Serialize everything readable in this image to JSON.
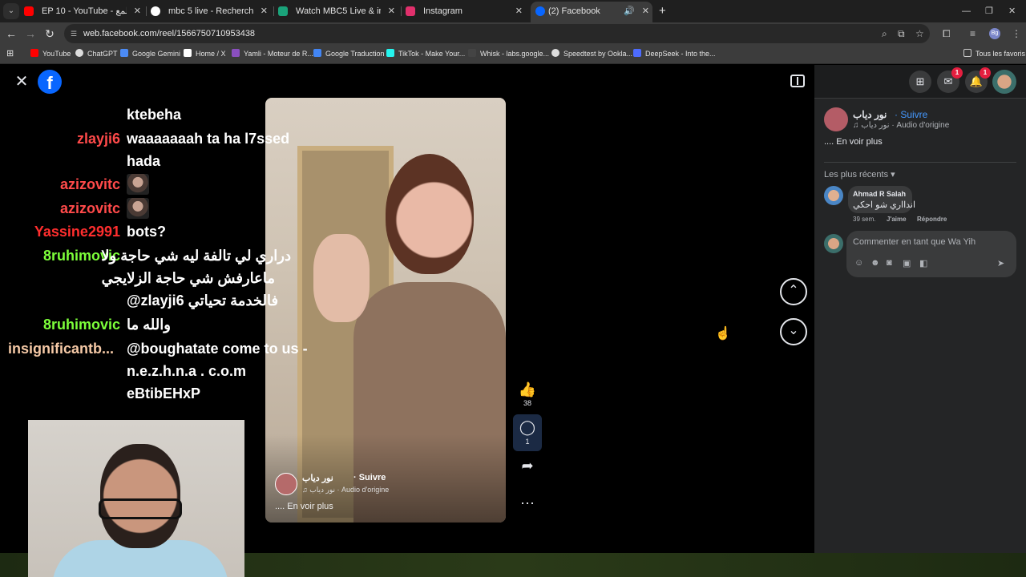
{
  "browser": {
    "tabs": [
      {
        "title": "EP 10 - YouTube - عش الطمع",
        "fav_color": "#ff0000",
        "close": "✕"
      },
      {
        "title": "mbc 5 live - Recherche Google",
        "fav_color": "#ffffff",
        "close": "✕"
      },
      {
        "title": "Watch MBC5 Live & in HD | Sh...",
        "fav_color": "#1aa37a",
        "close": "✕"
      },
      {
        "title": "Instagram",
        "fav_color": "#e1306c",
        "close": "✕"
      },
      {
        "title": "(2) Facebook",
        "fav_color": "#0866ff",
        "close": "✕"
      }
    ],
    "url": "web.facebook.com/reel/1566750710953438",
    "profile_initials": "Bg",
    "bookmarks": [
      {
        "label": "YouTube",
        "color": "#ff0000"
      },
      {
        "label": "ChatGPT",
        "color": "#dddddd"
      },
      {
        "label": "Google Gemini",
        "color": "#4c8bf5"
      },
      {
        "label": "Home / X",
        "color": "#ffffff"
      },
      {
        "label": "Yamli - Moteur de R...",
        "color": "#8a4fbf"
      },
      {
        "label": "Google Traduction",
        "color": "#4285f4"
      },
      {
        "label": "TikTok - Make Your...",
        "color": "#25f4ee"
      },
      {
        "label": "Whisk - labs.google...",
        "color": "#444444"
      },
      {
        "label": "Speedtest by Ookla...",
        "color": "#dddddd"
      },
      {
        "label": "DeepSeek - Into the...",
        "color": "#4d6bfe"
      }
    ],
    "all_bookmarks": "Tous les favoris"
  },
  "chat": [
    {
      "user": "",
      "user_color": "#ffffff",
      "lines": [
        "ktebeha"
      ]
    },
    {
      "user": "zlayji6",
      "user_color": "#ff4a4a",
      "lines": [
        "waaaaaaah ta ha l7ssed",
        "hada"
      ]
    },
    {
      "user": "azizovitc",
      "user_color": "#ff4a4a",
      "emote": true
    },
    {
      "user": "azizovitc",
      "user_color": "#ff4a4a",
      "emote": true
    },
    {
      "user": "Yassine2991",
      "user_color": "#ff2e2e",
      "lines": [
        "bots?"
      ]
    },
    {
      "user": "8ruhimovic",
      "user_color": "#7dff3a",
      "lines": [
        "دراري لي تالفة ليه شي حاجة ولا",
        "ماعارفش شي حاجة الزلايجي",
        "@zlayji6 فالخدمة تحياتي"
      ]
    },
    {
      "user": "8ruhimovic",
      "user_color": "#7dff3a",
      "lines": [
        "والله ما"
      ]
    },
    {
      "user": "insignificantb...",
      "user_color": "#f5c9a6",
      "lines": [
        "@boughatate come to us -",
        "n.e.z.h.n.a . c.o.m",
        "eBtibEHxP"
      ]
    }
  ],
  "reel": {
    "author": "نور دياب",
    "follow": "· Suivre",
    "audio": "♫ نور دياب · Audio d'origine",
    "see_more": ".... En voir plus",
    "likes": "38",
    "comments": "1"
  },
  "sidebar": {
    "notif_badge": "1",
    "messenger_badge": "1",
    "author": "نور دياب",
    "follow": "· Suivre",
    "audio": "♫ نور دياب · Audio d'origine",
    "see_more": ".... En voir plus",
    "sort": "Les plus récents ▾",
    "comment": {
      "name": "Ahmad R Salah",
      "text": "اندااري شو احكي",
      "time": "39 sem.",
      "like": "J'aime",
      "reply": "Répondre"
    },
    "composer_placeholder": "Commenter en tant que Wa Yih"
  }
}
